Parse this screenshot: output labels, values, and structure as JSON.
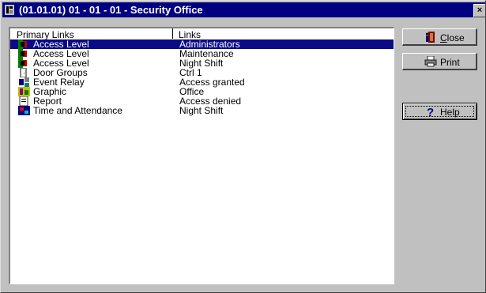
{
  "window": {
    "title": "(01.01.01) 01 - 01 - 01 - Security Office",
    "close_glyph": "×"
  },
  "list": {
    "headers": {
      "primary": "Primary Links",
      "links": "Links"
    },
    "rows": [
      {
        "icon": "access-level-icon",
        "primary": "Access Level",
        "link": "Administrators",
        "selected": true
      },
      {
        "icon": "access-level-icon",
        "primary": "Access Level",
        "link": "Maintenance",
        "selected": false
      },
      {
        "icon": "access-level-icon",
        "primary": "Access Level",
        "link": "Night Shift",
        "selected": false
      },
      {
        "icon": "door-groups-icon",
        "primary": "Door Groups",
        "link": "Ctrl 1",
        "selected": false
      },
      {
        "icon": "event-relay-icon",
        "primary": "Event Relay",
        "link": "Access granted",
        "selected": false
      },
      {
        "icon": "graphic-icon",
        "primary": "Graphic",
        "link": "Office",
        "selected": false
      },
      {
        "icon": "report-icon",
        "primary": "Report",
        "link": "Access denied",
        "selected": false
      },
      {
        "icon": "time-attendance-icon",
        "primary": "Time and Attendance",
        "link": "Night Shift",
        "selected": false
      }
    ]
  },
  "buttons": {
    "close": "Close",
    "print": "Print",
    "help": "Help"
  },
  "colors": {
    "title_bar": "#000080",
    "selection": "#0a0a84",
    "face": "#c0c0c0"
  }
}
